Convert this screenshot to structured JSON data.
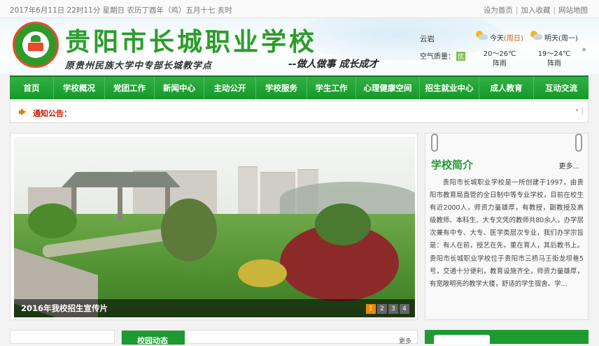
{
  "topbar": {
    "date": "2017年6月11日  22时11分    星期日    农历丁酉年（鸡）五月十七  亥时",
    "links": [
      "设为首页",
      "加入收藏",
      "网站地图"
    ]
  },
  "header": {
    "title": "贵阳市长城职业学校",
    "subtitle": "原贵州民族大学中专部长城教学点",
    "slogan": "--做人做事   成长成才"
  },
  "weather": {
    "city": "云岩",
    "aq_label": "空气质量：",
    "aq_value": "优",
    "today_label": "今天",
    "today_week": "(周日)",
    "today_temp": "20～26℃",
    "today_cond": "阵雨",
    "tomorrow_label": "明天(周一)",
    "tomorrow_temp": "19～24℃",
    "tomorrow_cond": "阵雨",
    "next_arrow": "»"
  },
  "nav": [
    "首页",
    "学校概况",
    "党团工作",
    "新闻中心",
    "主动公开",
    "学校服务",
    "学生工作",
    "心理健康空间",
    "招生就业中心",
    "成人教育",
    "互动交流"
  ],
  "notice": {
    "label": "通知公告：",
    "dots": "• ¦"
  },
  "slider": {
    "caption": "2016年我校招生宣传片",
    "pages": [
      "1",
      "2",
      "3",
      "4"
    ],
    "active_page": "1"
  },
  "intro": {
    "title": "学校简介",
    "more": "更多...",
    "body": "贵阳市长城职业学校是一所创建于1997，由贵阳市教育局直管的全日制中等专业学校，目前在校生有近2000人，师资力量雄厚，有教授，副教授及高级教师、本科生、大专文凭的教师共80余人，办学层次兼有中专、大专、医学类层次专业，我们办学宗旨是：有人在前，授艺在先，重在育人，其后教书上。 贵阳市长城职业学校位于贵阳市三桥马王街龙坝巷5号，交通十分便利，教育设施齐全，师资力量雄厚，有宽敞明亮的教学大楼，舒适的学生宿舍、学..."
  },
  "bottom": {
    "news_title": "校园动态",
    "more": "更多"
  },
  "colors": {
    "brand_green": "#1d9b30",
    "accent_orange": "#f08a00",
    "notice_red": "#c91c00"
  }
}
